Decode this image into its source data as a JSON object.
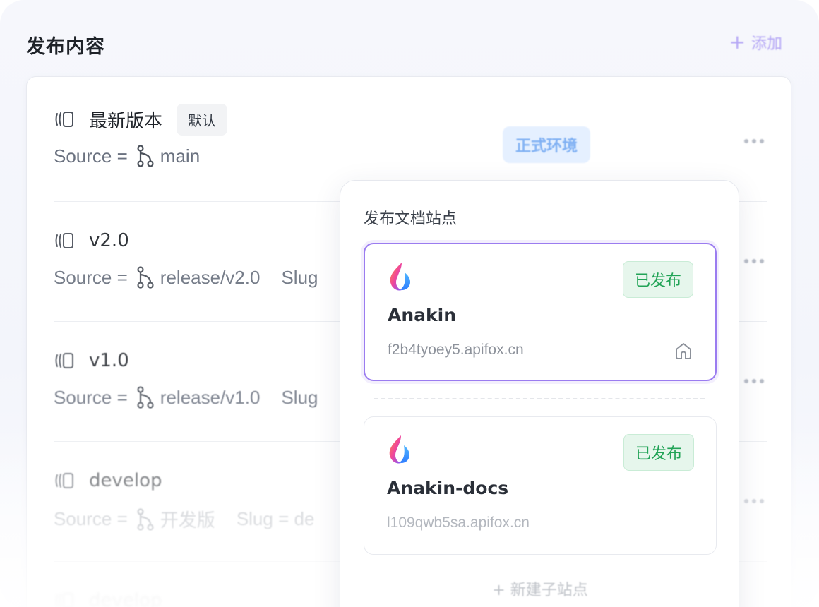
{
  "header": {
    "title": "发布内容",
    "add_label": "添加"
  },
  "versions": [
    {
      "name": "最新版本",
      "default_badge": "默认",
      "source_prefix": "Source =",
      "branch": "main",
      "slug": ""
    },
    {
      "name": "v2.0",
      "source_prefix": "Source =",
      "branch": "release/v2.0",
      "slug": "Slug"
    },
    {
      "name": "v1.0",
      "source_prefix": "Source =",
      "branch": "release/v1.0",
      "slug": "Slug"
    },
    {
      "name": "develop",
      "source_prefix": "Source =",
      "branch": "开发版",
      "slug": "Slug = de"
    },
    {
      "name": "develop"
    }
  ],
  "environment_tag": "正式环境",
  "popover": {
    "title": "发布文档站点",
    "sites": [
      {
        "name": "Anakin",
        "status": "已发布",
        "url": "f2b4tyoey5.apifox.cn"
      },
      {
        "name": "Anakin-docs",
        "status": "已发布",
        "url": "l109qwb5sa.apifox.cn"
      }
    ],
    "new_sub_site": "+ 新建子站点"
  },
  "colors": {
    "accent": "#9b7cf0",
    "published": "#21a356",
    "env": "#7fb0f3"
  }
}
